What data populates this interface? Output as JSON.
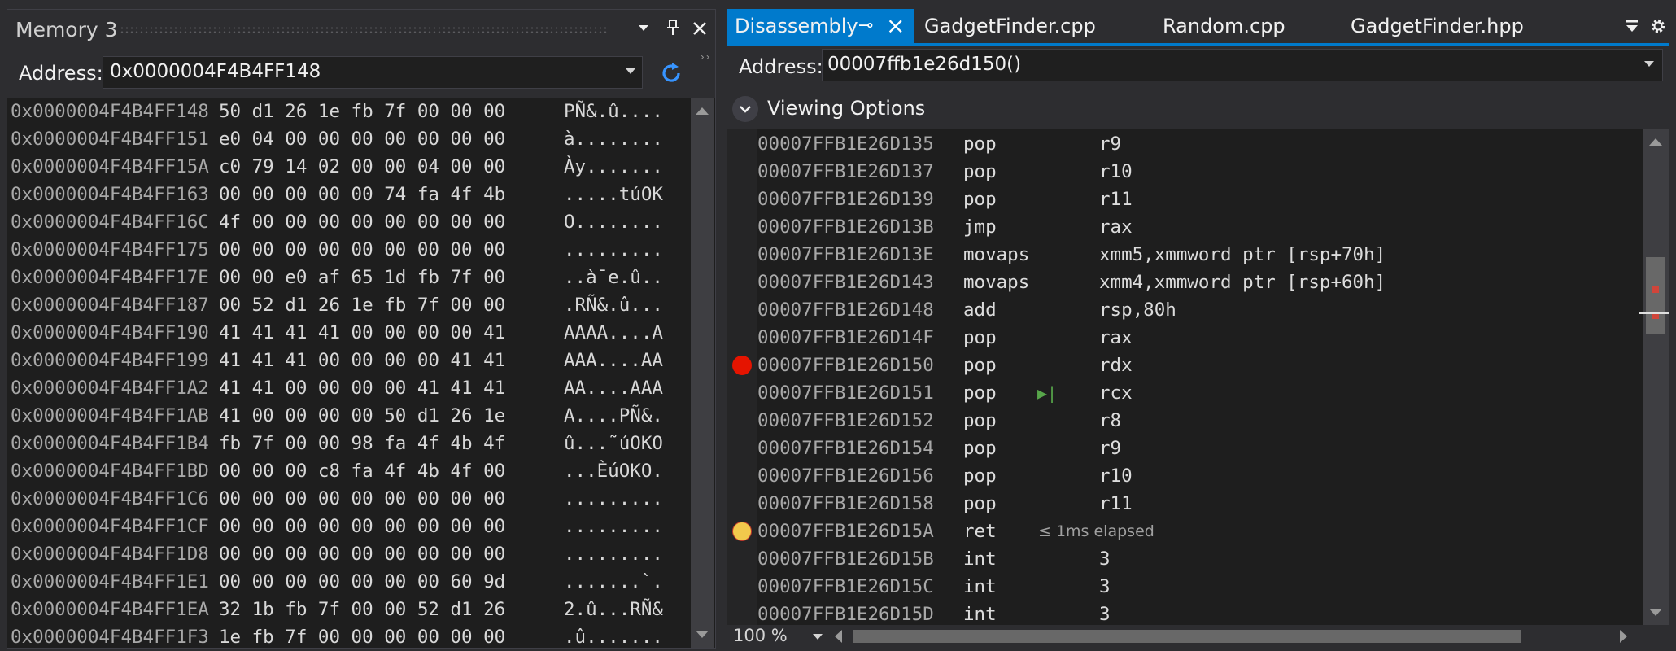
{
  "memory": {
    "title": "Memory 3",
    "address_label": "Address:",
    "address_value": "0x0000004F4B4FF148",
    "rows": [
      {
        "addr": "0x0000004F4B4FF148",
        "hex": "50 d1 26 1e fb 7f 00 00 00",
        "text": "PÑ&.û...."
      },
      {
        "addr": "0x0000004F4B4FF151",
        "hex": "e0 04 00 00 00 00 00 00 00",
        "text": "à........"
      },
      {
        "addr": "0x0000004F4B4FF15A",
        "hex": "c0 79 14 02 00 00 04 00 00",
        "text": "Ày......."
      },
      {
        "addr": "0x0000004F4B4FF163",
        "hex": "00 00 00 00 00 74 fa 4f 4b",
        "text": ".....túOK"
      },
      {
        "addr": "0x0000004F4B4FF16C",
        "hex": "4f 00 00 00 00 00 00 00 00",
        "text": "O........"
      },
      {
        "addr": "0x0000004F4B4FF175",
        "hex": "00 00 00 00 00 00 00 00 00",
        "text": "........."
      },
      {
        "addr": "0x0000004F4B4FF17E",
        "hex": "00 00 e0 af 65 1d fb 7f 00",
        "text": "..à¯e.û.."
      },
      {
        "addr": "0x0000004F4B4FF187",
        "hex": "00 52 d1 26 1e fb 7f 00 00",
        "text": ".RÑ&.û..."
      },
      {
        "addr": "0x0000004F4B4FF190",
        "hex": "41 41 41 41 00 00 00 00 41",
        "text": "AAAA....A"
      },
      {
        "addr": "0x0000004F4B4FF199",
        "hex": "41 41 41 00 00 00 00 41 41",
        "text": "AAA....AA"
      },
      {
        "addr": "0x0000004F4B4FF1A2",
        "hex": "41 41 00 00 00 00 41 41 41",
        "text": "AA....AAA"
      },
      {
        "addr": "0x0000004F4B4FF1AB",
        "hex": "41 00 00 00 00 50 d1 26 1e",
        "text": "A....PÑ&."
      },
      {
        "addr": "0x0000004F4B4FF1B4",
        "hex": "fb 7f 00 00 98 fa 4f 4b 4f",
        "text": "û...˜úOKO"
      },
      {
        "addr": "0x0000004F4B4FF1BD",
        "hex": "00 00 00 c8 fa 4f 4b 4f 00",
        "text": "...ÈúOKO."
      },
      {
        "addr": "0x0000004F4B4FF1C6",
        "hex": "00 00 00 00 00 00 00 00 00",
        "text": "........."
      },
      {
        "addr": "0x0000004F4B4FF1CF",
        "hex": "00 00 00 00 00 00 00 00 00",
        "text": "........."
      },
      {
        "addr": "0x0000004F4B4FF1D8",
        "hex": "00 00 00 00 00 00 00 00 00",
        "text": "........."
      },
      {
        "addr": "0x0000004F4B4FF1E1",
        "hex": "00 00 00 00 00 00 00 60 9d",
        "text": ".......`."
      },
      {
        "addr": "0x0000004F4B4FF1EA",
        "hex": "32 1b fb 7f 00 00 52 d1 26",
        "text": "2.û...RÑ&"
      },
      {
        "addr": "0x0000004F4B4FF1F3",
        "hex": "1e fb 7f 00 00 00 00 00 00",
        "text": ".û......."
      }
    ]
  },
  "disassembly": {
    "tabs": [
      {
        "label": "Disassembly",
        "active": true
      },
      {
        "label": "GadgetFinder.cpp",
        "active": false
      },
      {
        "label": "Random.cpp",
        "active": false
      },
      {
        "label": "GadgetFinder.hpp",
        "active": false
      }
    ],
    "address_label": "Address:",
    "address_value": "00007ffb1e26d150()",
    "viewing_options_label": "Viewing Options",
    "zoom": "100 %",
    "rows": [
      {
        "addr": "00007FFB1E26D135",
        "op": "pop",
        "args": "r9",
        "marker": "",
        "note": ""
      },
      {
        "addr": "00007FFB1E26D137",
        "op": "pop",
        "args": "r10",
        "marker": "",
        "note": ""
      },
      {
        "addr": "00007FFB1E26D139",
        "op": "pop",
        "args": "r11",
        "marker": "",
        "note": ""
      },
      {
        "addr": "00007FFB1E26D13B",
        "op": "jmp",
        "args": "rax",
        "marker": "",
        "note": ""
      },
      {
        "addr": "00007FFB1E26D13E",
        "op": "movaps",
        "args": "xmm5,xmmword ptr [rsp+70h]",
        "marker": "",
        "note": ""
      },
      {
        "addr": "00007FFB1E26D143",
        "op": "movaps",
        "args": "xmm4,xmmword ptr [rsp+60h]",
        "marker": "",
        "note": ""
      },
      {
        "addr": "00007FFB1E26D148",
        "op": "add",
        "args": "rsp,80h",
        "marker": "",
        "note": ""
      },
      {
        "addr": "00007FFB1E26D14F",
        "op": "pop",
        "args": "rax",
        "marker": "",
        "note": ""
      },
      {
        "addr": "00007FFB1E26D150",
        "op": "pop",
        "args": "rdx",
        "marker": "breakpoint",
        "note": ""
      },
      {
        "addr": "00007FFB1E26D151",
        "op": "pop",
        "args": "rcx",
        "marker": "run-to-cursor",
        "note": ""
      },
      {
        "addr": "00007FFB1E26D152",
        "op": "pop",
        "args": "r8",
        "marker": "",
        "note": ""
      },
      {
        "addr": "00007FFB1E26D154",
        "op": "pop",
        "args": "r9",
        "marker": "",
        "note": ""
      },
      {
        "addr": "00007FFB1E26D156",
        "op": "pop",
        "args": "r10",
        "marker": "",
        "note": ""
      },
      {
        "addr": "00007FFB1E26D158",
        "op": "pop",
        "args": "r11",
        "marker": "",
        "note": ""
      },
      {
        "addr": "00007FFB1E26D15A",
        "op": "ret",
        "args": "",
        "marker": "current",
        "note": "≤ 1ms elapsed"
      },
      {
        "addr": "00007FFB1E26D15B",
        "op": "int",
        "args": "3",
        "marker": "",
        "note": ""
      },
      {
        "addr": "00007FFB1E26D15C",
        "op": "int",
        "args": "3",
        "marker": "",
        "note": ""
      },
      {
        "addr": "00007FFB1E26D15D",
        "op": "int",
        "args": "3",
        "marker": "",
        "note": ""
      }
    ]
  },
  "colors": {
    "accent": "#007acc",
    "breakpoint": "#e51400",
    "current_statement": "#f2c94c",
    "run_to_cursor": "#57a64a"
  },
  "icons": [
    "chevron-down-icon",
    "pin-icon",
    "close-icon",
    "refresh-icon",
    "tab-overflow-icon",
    "gear-icon",
    "breakpoint-icon",
    "current-statement-icon",
    "run-to-cursor-icon"
  ]
}
